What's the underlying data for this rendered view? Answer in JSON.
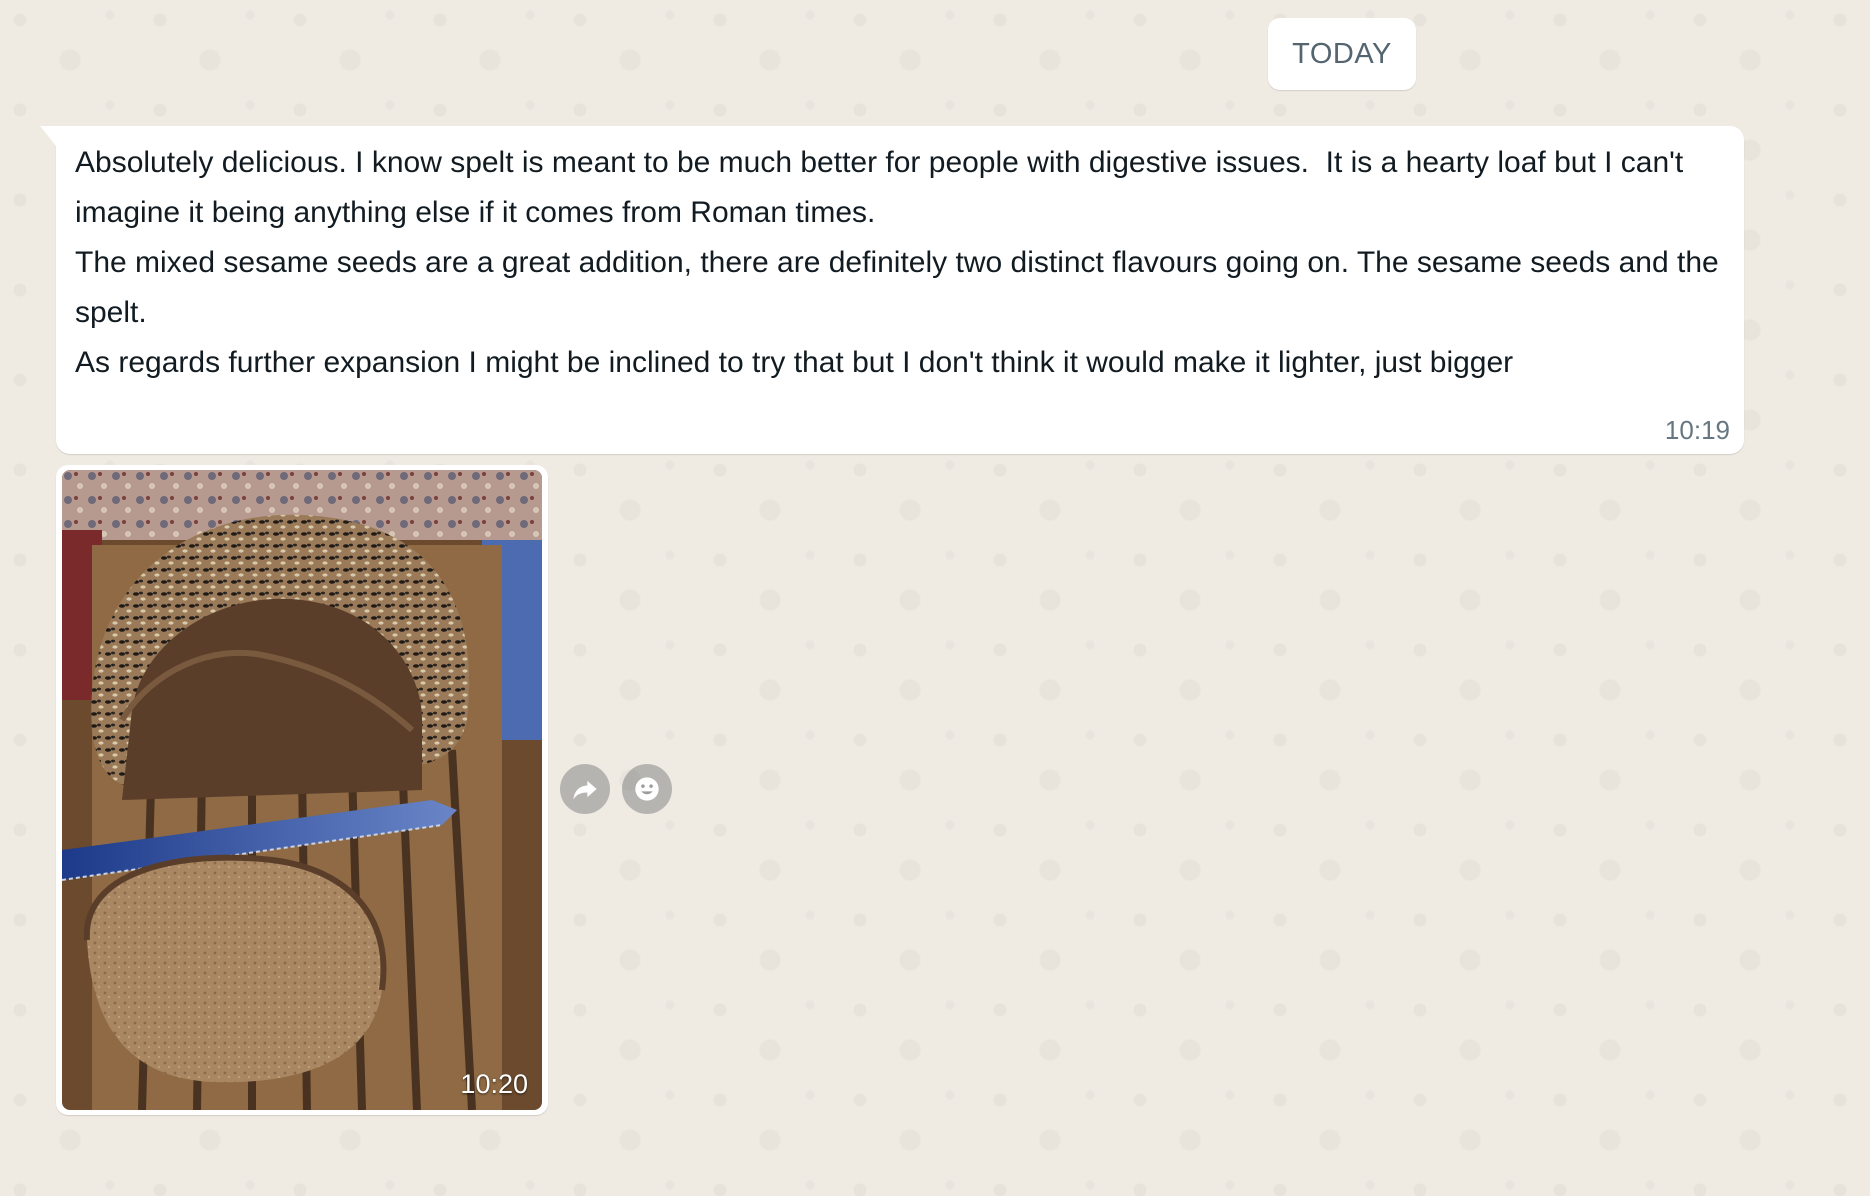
{
  "date_divider": "TODAY",
  "messages": [
    {
      "type": "text",
      "text": "Absolutely delicious. I know spelt is meant to be much better for people with digestive issues.  It is a hearty loaf but I can't imagine it being anything else if it comes from Roman times.\nThe mixed sesame seeds are a great addition, there are definitely two distinct flavours going on. The sesame seeds and the spelt.\nAs regards further expansion I might be inclined to try that but I don't think it would make it lighter, just bigger",
      "time": "10:19"
    },
    {
      "type": "image",
      "time": "10:20"
    }
  ],
  "hover_actions": {
    "forward_icon": "forward-arrow-icon",
    "react_icon": "smiley-icon"
  },
  "colors": {
    "chat_background": "#efeae2",
    "bubble_incoming": "#ffffff",
    "timestamp": "#667781",
    "action_button": "#a3a3a0"
  }
}
